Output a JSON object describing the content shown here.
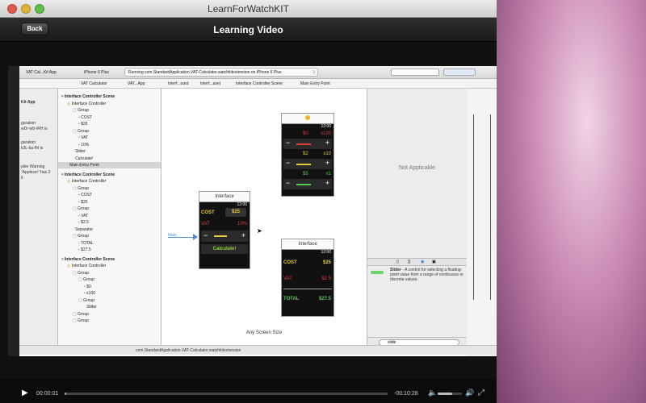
{
  "window": {
    "title": "LearnForWatchKIT"
  },
  "header": {
    "back_label": "Back",
    "title": "Learning Video"
  },
  "xcode": {
    "scheme": "VAT Cal...Kit App",
    "device": "iPhone 6 Plus",
    "running": "Running com.StandardApplication.VAT-Calculator.watchkitextension on iPhone 6 Plus",
    "warning_count": "3",
    "breadcrumbs": [
      "VAT Calculator",
      "VAT...App",
      "Interf...oard",
      "Interf...ase)",
      "Interface Controller Scene",
      "Main Entry Point"
    ],
    "navigator": [
      "Kit App",
      "guration",
      "wDr-w8-rRH is",
      "guration",
      "k3L-bu-fhl is",
      "piler Warning",
      "\"Applicon\" has 2",
      "it"
    ],
    "outline": [
      {
        "label": "Interface Controller Scene",
        "depth": 0,
        "kind": "header"
      },
      {
        "label": "Interface Controller",
        "depth": 1,
        "kind": "ctrl"
      },
      {
        "label": "Group",
        "depth": 2,
        "kind": "group"
      },
      {
        "label": "COST",
        "depth": 3,
        "kind": "label"
      },
      {
        "label": "$25",
        "depth": 3,
        "kind": "label"
      },
      {
        "label": "Group",
        "depth": 2,
        "kind": "group"
      },
      {
        "label": "VAT",
        "depth": 3,
        "kind": "label"
      },
      {
        "label": "10%",
        "depth": 3,
        "kind": "label"
      },
      {
        "label": "Slider",
        "depth": 2,
        "kind": "item"
      },
      {
        "label": "Calculate!",
        "depth": 2,
        "kind": "item"
      },
      {
        "label": "Main Entry Point",
        "depth": 1,
        "kind": "entry",
        "selected": true
      },
      {
        "label": "Interface Controller Scene",
        "depth": 0,
        "kind": "header"
      },
      {
        "label": "Interface Controller",
        "depth": 1,
        "kind": "ctrl"
      },
      {
        "label": "Group",
        "depth": 2,
        "kind": "group"
      },
      {
        "label": "COST",
        "depth": 3,
        "kind": "label"
      },
      {
        "label": "$25",
        "depth": 3,
        "kind": "label"
      },
      {
        "label": "Group",
        "depth": 2,
        "kind": "group"
      },
      {
        "label": "VAT",
        "depth": 3,
        "kind": "label"
      },
      {
        "label": "$2.5",
        "depth": 3,
        "kind": "label"
      },
      {
        "label": "Separator",
        "depth": 2,
        "kind": "item"
      },
      {
        "label": "Group",
        "depth": 2,
        "kind": "group"
      },
      {
        "label": "TOTAL",
        "depth": 3,
        "kind": "label"
      },
      {
        "label": "$27.5",
        "depth": 3,
        "kind": "label"
      },
      {
        "label": "Interface Controller Scene",
        "depth": 0,
        "kind": "header"
      },
      {
        "label": "Interface Controller",
        "depth": 1,
        "kind": "ctrl"
      },
      {
        "label": "Group",
        "depth": 2,
        "kind": "group"
      },
      {
        "label": "Group",
        "depth": 3,
        "kind": "group"
      },
      {
        "label": "$0",
        "depth": 4,
        "kind": "label"
      },
      {
        "label": "x100",
        "depth": 4,
        "kind": "label"
      },
      {
        "label": "Group",
        "depth": 3,
        "kind": "group"
      },
      {
        "label": "Slider",
        "depth": 4,
        "kind": "item"
      },
      {
        "label": "Group",
        "depth": 2,
        "kind": "group"
      },
      {
        "label": "Group",
        "depth": 2,
        "kind": "group"
      }
    ],
    "canvas": {
      "any_size": "Any Screen Size",
      "main_label": "Main",
      "scene1": {
        "head": "Interface",
        "time": "12:00",
        "cost_label": "COST",
        "cost_value": "$25",
        "vat_label": "VAT",
        "vat_value": "10%",
        "calc": "Calculate!"
      },
      "scene2": {
        "time": "12:00",
        "rows": [
          {
            "left": "$0",
            "right": "x100"
          },
          {
            "left": "$2",
            "right": "x10"
          },
          {
            "left": "$5",
            "right": "x1"
          }
        ]
      },
      "scene3": {
        "head": "Interface",
        "time": "12:00",
        "cost_label": "COST",
        "cost_value": "$25",
        "vat_label": "VAT",
        "vat_value": "$2.5",
        "total_label": "TOTAL",
        "total_value": "$27.5"
      }
    },
    "inspector": {
      "not_applicable": "Not Applicable",
      "slider_title": "Slider",
      "slider_desc": "- A control for selecting a floating-point value from a range of continuous or discrete values.",
      "filter": "slide"
    },
    "bottom": {
      "path": "com.StandardApplication.VAT-Calculator.watchkitextension"
    }
  },
  "player": {
    "elapsed": "00:00:01",
    "remaining": "-00:10:28",
    "progress": 0.005,
    "volume": 0.6
  },
  "colors": {
    "cost": "#e6cc3a",
    "vat": "#e23b3b",
    "total": "#4fcf4f",
    "calc": "#8fd63a"
  }
}
